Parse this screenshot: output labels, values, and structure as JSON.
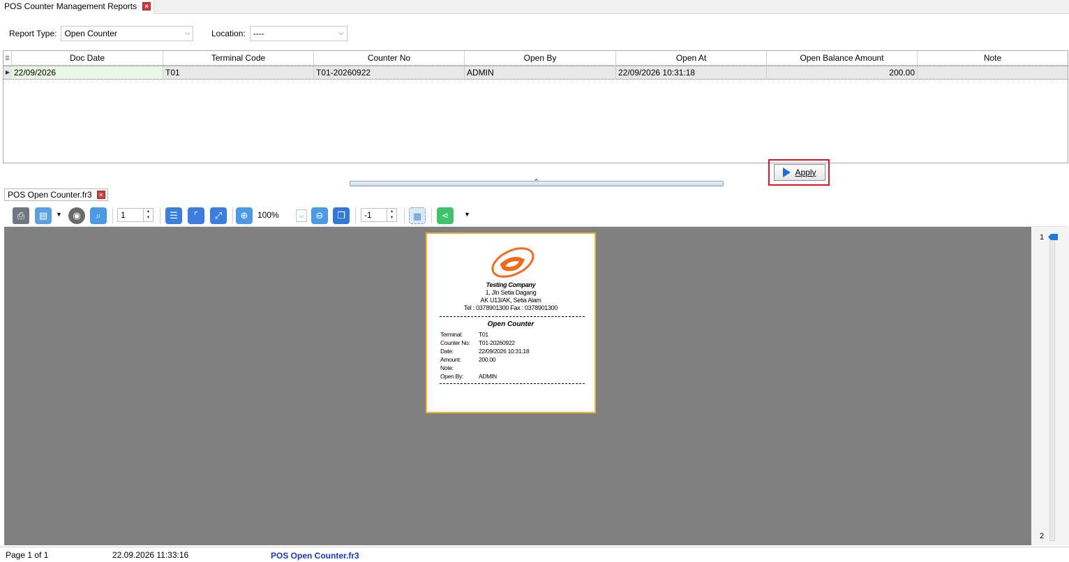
{
  "window_tab": {
    "title": "POS Counter Management Reports",
    "close": "×"
  },
  "filters": {
    "report_type_label": "Report Type:",
    "report_type_value": "Open Counter",
    "location_label": "Location:",
    "location_value": "----"
  },
  "grid": {
    "columns": [
      "Doc Date",
      "Terminal Code",
      "Counter No",
      "Open By",
      "Open At",
      "Open Balance Amount",
      "Note"
    ],
    "rows": [
      [
        "22/09/2026",
        "T01",
        "T01-20260922",
        "ADMIN",
        "22/09/2026 10:31:18",
        "200.00",
        ""
      ]
    ]
  },
  "apply_label": "Apply",
  "report_tab": {
    "title": "POS Open Counter.fr3",
    "close": "×"
  },
  "toolbar": {
    "page_value": "1",
    "zoom_value": "100%",
    "minus_value": "-1"
  },
  "receipt": {
    "company_name": "Testing Company",
    "address1": "1, Jln Setia Dagang",
    "address2": "AK U13/AK, Setia Alam",
    "contact": "Tel : 0378901300    Fax : 0378901300",
    "title": "Open Counter",
    "fields": [
      {
        "label": "Terminal:",
        "value": "T01"
      },
      {
        "label": "Counter No:",
        "value": "T01-20260922"
      },
      {
        "label": "Date:",
        "value": "22/09/2026 10:31:18"
      },
      {
        "label": "Amount:",
        "value": "200.00"
      },
      {
        "label": "Note:",
        "value": ""
      },
      {
        "label": "Open By:",
        "value": "ADMIN"
      }
    ]
  },
  "page_nav": {
    "first": "1",
    "last": "2"
  },
  "status": {
    "page": "Page 1 of 1",
    "datetime": "22.09.2026 11:33:16",
    "file": "POS Open Counter.fr3"
  },
  "colors": {
    "accent": "#1f6fd6",
    "highlight": "#e0141e",
    "preview_bg": "#808080"
  }
}
